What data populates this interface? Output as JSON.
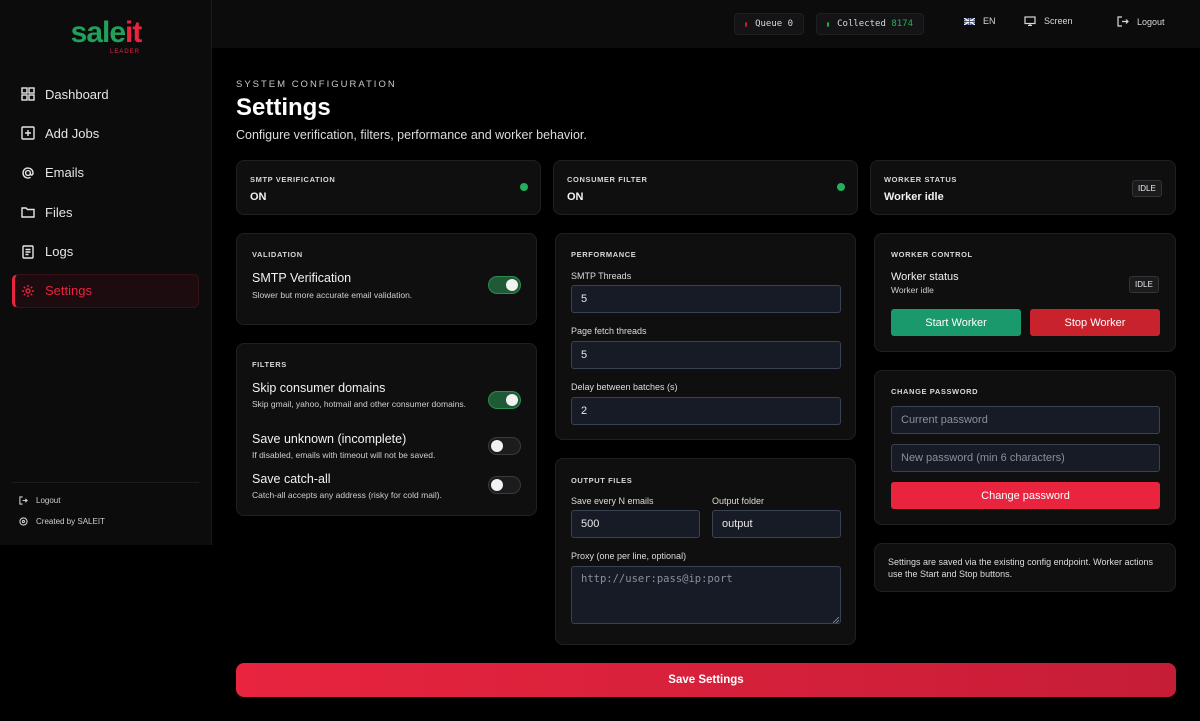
{
  "brand": {
    "logo_part1": "sale",
    "logo_part2": "it",
    "logo_sub": "LEADER"
  },
  "sidebar": {
    "items": [
      {
        "label": "Dashboard",
        "icon": "grid-icon"
      },
      {
        "label": "Add Jobs",
        "icon": "plus-square-icon"
      },
      {
        "label": "Emails",
        "icon": "at-icon"
      },
      {
        "label": "Files",
        "icon": "folder-icon"
      },
      {
        "label": "Logs",
        "icon": "file-text-icon"
      },
      {
        "label": "Settings",
        "icon": "gear-icon",
        "active": true
      }
    ],
    "logout_label": "Logout",
    "credit": "Created by SALEIT"
  },
  "topbar": {
    "queue_label": "Queue",
    "queue_value": "0",
    "collected_label": "Collected",
    "collected_value": "8174",
    "language": "EN",
    "screen_label": "Screen",
    "logout_label": "Logout"
  },
  "header": {
    "eyebrow": "SYSTEM CONFIGURATION",
    "title": "Settings",
    "subtitle": "Configure verification, filters, performance and worker behavior."
  },
  "status": {
    "smtp": {
      "caption": "SMTP VERIFICATION",
      "value": "ON"
    },
    "consumer": {
      "caption": "CONSUMER FILTER",
      "value": "ON"
    },
    "worker": {
      "caption": "WORKER STATUS",
      "value": "Worker idle",
      "badge": "IDLE"
    }
  },
  "validation": {
    "caption": "VALIDATION",
    "smtp_title": "SMTP Verification",
    "smtp_desc": "Slower but more accurate email validation.",
    "smtp_on": true
  },
  "filters": {
    "caption": "FILTERS",
    "items": [
      {
        "title": "Skip consumer domains",
        "desc": "Skip gmail, yahoo, hotmail and other consumer domains.",
        "on": true
      },
      {
        "title": "Save unknown (incomplete)",
        "desc": "If disabled, emails with timeout will not be saved.",
        "on": false
      },
      {
        "title": "Save catch-all",
        "desc": "Catch-all accepts any address (risky for cold mail).",
        "on": false
      }
    ]
  },
  "performance": {
    "caption": "PERFORMANCE",
    "smtp_threads_label": "SMTP Threads",
    "smtp_threads": "5",
    "page_threads_label": "Page fetch threads",
    "page_threads": "5",
    "delay_label": "Delay between batches (s)",
    "delay": "2"
  },
  "output": {
    "caption": "OUTPUT FILES",
    "save_every_label": "Save every N emails",
    "save_every": "500",
    "folder_label": "Output folder",
    "folder": "output",
    "proxy_label": "Proxy (one per line, optional)",
    "proxy_placeholder": "http://user:pass@ip:port"
  },
  "worker_control": {
    "caption": "WORKER CONTROL",
    "status_label": "Worker status",
    "status_sub": "Worker idle",
    "badge": "IDLE",
    "start_label": "Start Worker",
    "stop_label": "Stop Worker"
  },
  "password": {
    "caption": "CHANGE PASSWORD",
    "current_placeholder": "Current password",
    "new_placeholder": "New password (min 6 characters)",
    "button_label": "Change password"
  },
  "note": "Settings are saved via the existing config endpoint. Worker actions use the Start and Stop buttons.",
  "save_label": "Save Settings",
  "colors": {
    "accent": "#e8243f",
    "green": "#22b05a",
    "start_btn": "#1a9a6c",
    "stop_btn": "#c8232c"
  }
}
